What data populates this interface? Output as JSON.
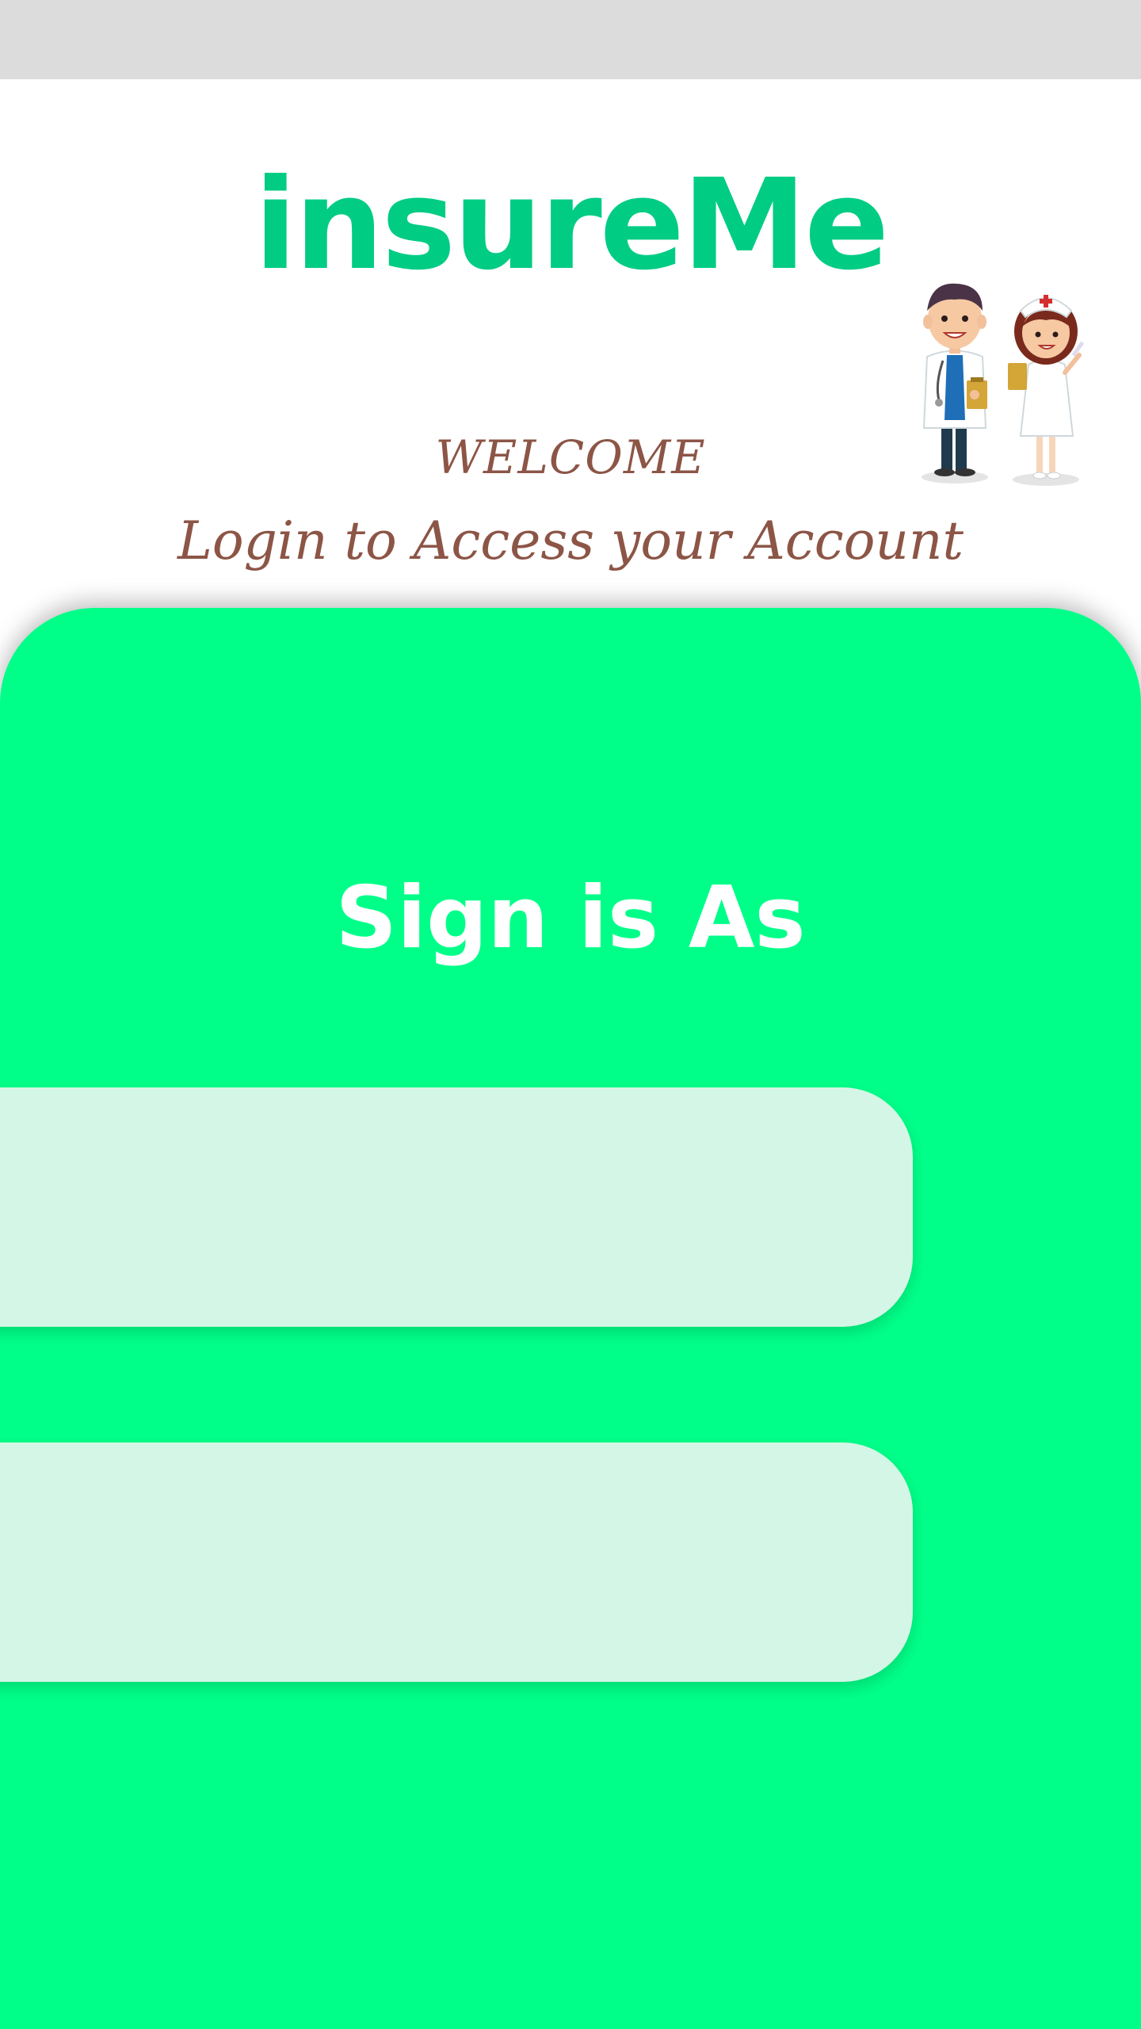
{
  "header": {
    "app_name": "insureMe",
    "welcome": "WELCOME",
    "subtitle": "Login to Access your Account",
    "illustration_icon": "doctor-and-nurse-illustration"
  },
  "signin": {
    "title": "Sign is As",
    "options": [
      {
        "label": ""
      },
      {
        "label": ""
      }
    ]
  },
  "colors": {
    "brand_green": "#00cc84",
    "card_green": "#00ff89",
    "option_bg": "#d4f6e6",
    "text_brown": "#8c5546",
    "status_bar": "#dcdcdc"
  }
}
